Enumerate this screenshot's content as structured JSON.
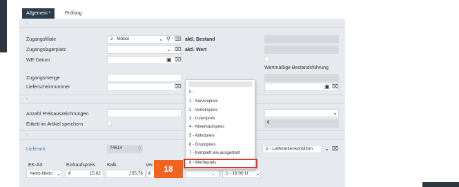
{
  "tabs": [
    {
      "label": "Allgemein *"
    },
    {
      "label": "Prüfung"
    }
  ],
  "section1": {
    "zugangsfiliale": {
      "label": "Zugangsfiliale",
      "value": "2 - Möbel"
    },
    "zugangslagerplatz": {
      "label": "Zugangslagerplatz",
      "value": ""
    },
    "we_datum": {
      "label": "WE-Datum",
      "value": ""
    },
    "aktl_bestand": {
      "label": "aktl. Bestand"
    },
    "aktl_wert": {
      "label": "aktl. Wert"
    },
    "wertmaessige": {
      "label": "Wertmäßige Bestandsführung"
    },
    "zugangsmenge": {
      "label": "Zugangsmenge"
    },
    "lieferscheinnummer": {
      "label": "Lieferscheinnummer"
    }
  },
  "section2": {
    "anzahl": {
      "label": "Anzahl Preisauszeichnungen"
    },
    "etikett": {
      "label": "Etikett im Artikel speichern"
    },
    "currency": "€"
  },
  "section3": {
    "lieferant": {
      "label": "Lieferant",
      "value": "74614"
    },
    "lieferantenkondition": {
      "value": "1 - Lieferantenkondition"
    },
    "ek_art": {
      "label": "EK-Art",
      "value": "Netto-Netto"
    },
    "einkaufspreis": {
      "label": "Einkaufspreis",
      "currency": "€",
      "value": "15,62"
    },
    "kalk": {
      "label": "Kalk.",
      "value": "255,76"
    },
    "ver": {
      "label": "Ver",
      "currency": "€"
    },
    "tax": {
      "value": "1 - 19.00 U"
    }
  },
  "dropdown": {
    "items": [
      "0 -",
      "1 - Servicepreis",
      "2 - Vorteilspreis",
      "3 - Listenpreis",
      "4 - Abverkaufspreis",
      "5 - Abholpreis",
      "6 - Grundpreis",
      "7 - Komplett wie ausgestellt",
      "8 - Werbepreis"
    ],
    "highlighted_index": 8
  },
  "step_badge": {
    "number": "18"
  },
  "colors": {
    "accent": "#2e3d4d",
    "highlight": "#d9392b",
    "badge": "#f26322",
    "link": "#3a86c8"
  }
}
